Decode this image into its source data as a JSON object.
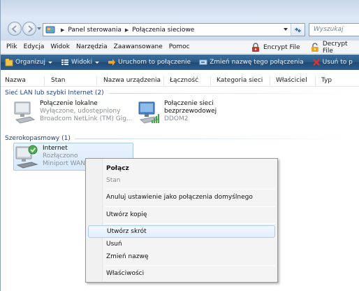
{
  "address": {
    "segments": [
      "Panel sterowania",
      "Połączenia sieciowe"
    ],
    "search_placeholder": "Wyszukaj"
  },
  "menubar": {
    "items": [
      "Plik",
      "Edycja",
      "Widok",
      "Narzędzia",
      "Zaawansowane",
      "Pomoc"
    ],
    "encrypt": "Encrypt File",
    "decrypt": "Decrypt File"
  },
  "cmdbar": {
    "organize": "Organizuj",
    "views": "Widoki",
    "start": "Uruchom to połączenie",
    "rename": "Zmień nazwę tego połączenia",
    "delete": "Usuń to p"
  },
  "columns": [
    "Nazwa",
    "Stan",
    "Nazwa urządzenia",
    "Łączność",
    "Kategoria sieci",
    "Właściciel",
    "Typ"
  ],
  "groups": [
    {
      "title": "Sieć LAN lub szybki Internet (2)",
      "items": [
        {
          "name": "Połączenie lokalne",
          "status": "Wyłączone, udostępniony",
          "device": "Broadcom NetLink (TM) Gig..."
        },
        {
          "name": "Połączenie sieci bezprzewodowej",
          "name_line1": "Połączenie sieci",
          "name_line2": "bezprzewodowej",
          "device": "DDOM2"
        }
      ]
    },
    {
      "title": "Szerokopasmowy (1)",
      "items": [
        {
          "name": "Internet",
          "status": "Rozłączono",
          "device": "Miniport WAN"
        }
      ]
    }
  ],
  "context_menu": {
    "items": [
      {
        "label": "Połącz",
        "style": "bold"
      },
      {
        "label": "Stan",
        "style": "disabled"
      },
      {
        "label": "Anuluj ustawienie jako połączenia domyślnego",
        "style": "normal"
      },
      {
        "label": "Utwórz kopię",
        "style": "normal"
      },
      {
        "label": "Utwórz skrót",
        "style": "hover"
      },
      {
        "label": "Usuń",
        "style": "normal"
      },
      {
        "label": "Zmień nazwę",
        "style": "normal"
      },
      {
        "label": "Właściwości",
        "style": "normal"
      }
    ]
  },
  "colors": {
    "command_bar": "#2b5a86",
    "group_header": "#1e3f8a",
    "selection": "#d7e9fb"
  }
}
